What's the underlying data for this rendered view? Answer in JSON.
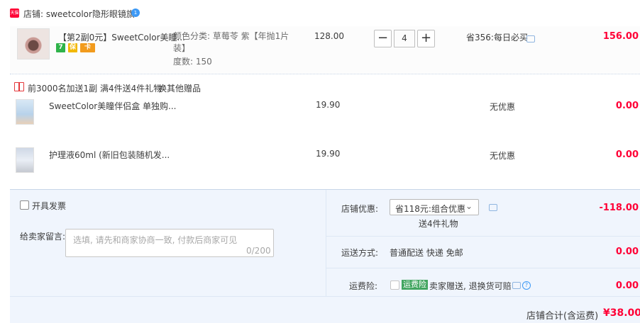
{
  "shop": {
    "badge": "天猫",
    "name": "店铺: sweetcolor隐形眼镜旗",
    "ww_icon": "1"
  },
  "main_item": {
    "title": "【第2副0元】SweetColor美瞳...",
    "tags": [
      "7",
      "保",
      "卡"
    ],
    "sku_color": "颜色分类: 草莓苓 紫【年抛1片",
    "sku_color_2": "装】",
    "sku_degree": "度数: 150",
    "price": "128.00",
    "qty": "4",
    "qty_minus": "−",
    "qty_plus": "+",
    "promo": "省356:每日必买",
    "sum": "156.00"
  },
  "gift": {
    "text_1": "前3000名加送1副",
    "text_2": "满4件送4件礼物",
    "change_link": "换其他赠品"
  },
  "gift_items": [
    {
      "title": "SweetColor美瞳伴侣盒 单独购...",
      "price": "19.90",
      "promo": "无优惠",
      "sum": "0.00"
    },
    {
      "title": "护理液60ml (新旧包装随机发...",
      "price": "19.90",
      "promo": "无优惠",
      "sum": "0.00"
    }
  ],
  "footer": {
    "invoice_label": "开具发票",
    "message_label": "给卖家留言:",
    "message_placeholder": "选填, 请先和商家协商一致, 付款后商家可见",
    "message_count": "0/200",
    "shop_discount_label": "店铺优惠:",
    "shop_discount_value": "省118元:组合优惠",
    "shop_discount_sub": "送4件礼物",
    "shop_discount_amount": "-118.00",
    "shipping_label": "运送方式:",
    "shipping_value": "普通配送 快递 免邮",
    "shipping_amount": "0.00",
    "insurance_label": "运费险:",
    "insurance_badge": "运费险",
    "insurance_text": "卖家赠送, 退换货可赔",
    "insurance_amount": "0.00",
    "total_label": "店铺合计(含运费)",
    "total_value": "¥38.00"
  },
  "colors": {
    "accent_red": "#ff0036",
    "tmall_red": "#ff0036",
    "link_orange": "#c87c3b",
    "footer_bg": "#f0f5fd",
    "green_badge": "#42a560",
    "blue_icon": "#3d99f5"
  },
  "icons": [
    "tmall-badge-icon",
    "wangwang-icon",
    "gift-icon",
    "chat-icon",
    "help-icon",
    "dropdown-chevron-icon",
    "checkbox-icon"
  ]
}
